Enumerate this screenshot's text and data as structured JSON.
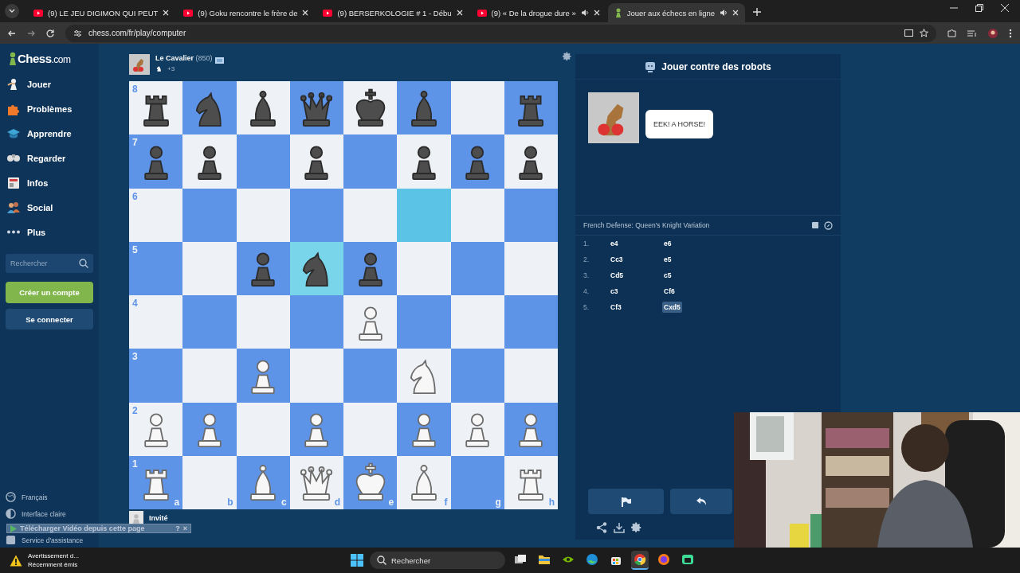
{
  "browser": {
    "tabs": [
      {
        "title": "(9) LE JEU DIGIMON QUI PEUT",
        "kind": "youtube",
        "audio": false,
        "selected": false
      },
      {
        "title": "(9) Goku rencontre le frère de",
        "kind": "youtube",
        "audio": false,
        "selected": false
      },
      {
        "title": "(9) BERSERKOLOGIE # 1 - Débu",
        "kind": "youtube",
        "audio": false,
        "selected": false
      },
      {
        "title": "(9) « De la drogue dure »",
        "kind": "youtube",
        "audio": true,
        "selected": false
      },
      {
        "title": "Jouer aux échecs en ligne",
        "kind": "chess",
        "audio": true,
        "selected": true
      }
    ],
    "address": "chess.com/fr/play/computer"
  },
  "sidebar": {
    "logo": {
      "name": "Chess",
      ".com": ".com"
    },
    "nav": [
      {
        "label": "Jouer"
      },
      {
        "label": "Problèmes"
      },
      {
        "label": "Apprendre"
      },
      {
        "label": "Regarder"
      },
      {
        "label": "Infos"
      },
      {
        "label": "Social"
      },
      {
        "label": "Plus"
      }
    ],
    "search": {
      "placeholder": "Rechercher"
    },
    "buttons": [
      {
        "label": "Créer un compte",
        "kind": "primary"
      },
      {
        "label": "Se connecter",
        "kind": "secondary"
      }
    ],
    "footer": [
      {
        "label": "Français"
      },
      {
        "label": "Interface claire"
      },
      {
        "label": "Service d'assistance"
      }
    ]
  },
  "download_bar": {
    "label": "Télécharger Vidéo depuis cette page",
    "help": "?",
    "close": "×"
  },
  "opponent": {
    "name": "Le Cavalier",
    "rating": "(850)",
    "captured": "+3"
  },
  "player": {
    "name": "Invité"
  },
  "board": {
    "files": [
      "a",
      "b",
      "c",
      "d",
      "e",
      "f",
      "g",
      "h"
    ],
    "ranks": [
      {
        "label": "8",
        "squares": [
          {
            "kind": "rook",
            "black": true,
            "highlighted": false
          },
          {
            "kind": "knight",
            "black": true,
            "highlighted": false
          },
          {
            "kind": "bishop",
            "black": true,
            "highlighted": false
          },
          {
            "kind": "queen",
            "black": true,
            "highlighted": false
          },
          {
            "kind": "king",
            "black": true,
            "highlighted": false
          },
          {
            "kind": "bishop",
            "black": true,
            "highlighted": false
          },
          {
            "kind": "empty",
            "highlighted": false
          },
          {
            "kind": "rook",
            "black": true,
            "highlighted": false
          }
        ]
      },
      {
        "label": "7",
        "squares": [
          {
            "kind": "pawn",
            "black": true,
            "highlighted": false
          },
          {
            "kind": "pawn",
            "black": true,
            "highlighted": false
          },
          {
            "kind": "empty",
            "highlighted": false
          },
          {
            "kind": "pawn",
            "black": true,
            "highlighted": false
          },
          {
            "kind": "empty",
            "highlighted": false
          },
          {
            "kind": "pawn",
            "black": true,
            "highlighted": false
          },
          {
            "kind": "pawn",
            "black": true,
            "highlighted": false
          },
          {
            "kind": "pawn",
            "black": true,
            "highlighted": false
          }
        ]
      },
      {
        "label": "6",
        "squares": [
          {
            "kind": "empty",
            "highlighted": false
          },
          {
            "kind": "empty",
            "highlighted": false
          },
          {
            "kind": "empty",
            "highlighted": false
          },
          {
            "kind": "empty",
            "highlighted": false
          },
          {
            "kind": "empty",
            "highlighted": false
          },
          {
            "kind": "empty",
            "highlighted": true
          },
          {
            "kind": "empty",
            "highlighted": false
          },
          {
            "kind": "empty",
            "highlighted": false
          }
        ]
      },
      {
        "label": "5",
        "squares": [
          {
            "kind": "empty",
            "highlighted": false
          },
          {
            "kind": "empty",
            "highlighted": false
          },
          {
            "kind": "pawn",
            "black": true,
            "highlighted": false
          },
          {
            "kind": "knight",
            "black": true,
            "highlighted": true
          },
          {
            "kind": "pawn",
            "black": true,
            "highlighted": false
          },
          {
            "kind": "empty",
            "highlighted": false
          },
          {
            "kind": "empty",
            "highlighted": false
          },
          {
            "kind": "empty",
            "highlighted": false
          }
        ]
      },
      {
        "label": "4",
        "squares": [
          {
            "kind": "empty",
            "highlighted": false
          },
          {
            "kind": "empty",
            "highlighted": false
          },
          {
            "kind": "empty",
            "highlighted": false
          },
          {
            "kind": "empty",
            "highlighted": false
          },
          {
            "kind": "pawn",
            "black": false,
            "highlighted": false
          },
          {
            "kind": "empty",
            "highlighted": false
          },
          {
            "kind": "empty",
            "highlighted": false
          },
          {
            "kind": "empty",
            "highlighted": false
          }
        ]
      },
      {
        "label": "3",
        "squares": [
          {
            "kind": "empty",
            "highlighted": false
          },
          {
            "kind": "empty",
            "highlighted": false
          },
          {
            "kind": "pawn",
            "black": false,
            "highlighted": false
          },
          {
            "kind": "empty",
            "highlighted": false
          },
          {
            "kind": "empty",
            "highlighted": false
          },
          {
            "kind": "knight",
            "black": false,
            "highlighted": false
          },
          {
            "kind": "empty",
            "highlighted": false
          },
          {
            "kind": "empty",
            "highlighted": false
          }
        ]
      },
      {
        "label": "2",
        "squares": [
          {
            "kind": "pawn",
            "black": false,
            "highlighted": false
          },
          {
            "kind": "pawn",
            "black": false,
            "highlighted": false
          },
          {
            "kind": "empty",
            "highlighted": false
          },
          {
            "kind": "pawn",
            "black": false,
            "highlighted": false
          },
          {
            "kind": "empty",
            "highlighted": false
          },
          {
            "kind": "pawn",
            "black": false,
            "highlighted": false
          },
          {
            "kind": "pawn",
            "black": false,
            "highlighted": false
          },
          {
            "kind": "pawn",
            "black": false,
            "highlighted": false
          }
        ]
      },
      {
        "label": "1",
        "squares": [
          {
            "kind": "rook",
            "black": false,
            "highlighted": false
          },
          {
            "kind": "empty",
            "highlighted": false
          },
          {
            "kind": "bishop",
            "black": false,
            "highlighted": false
          },
          {
            "kind": "queen",
            "black": false,
            "highlighted": false
          },
          {
            "kind": "king",
            "black": false,
            "highlighted": false
          },
          {
            "kind": "bishop",
            "black": false,
            "highlighted": false
          },
          {
            "kind": "empty",
            "highlighted": false
          },
          {
            "kind": "rook",
            "black": false,
            "highlighted": false
          }
        ]
      }
    ]
  },
  "panel": {
    "title": "Jouer contre des robots",
    "bot_message": "EEK! A HORSE!",
    "opening": "French Defense: Queen's Knight Variation",
    "moves": [
      {
        "number": "1.",
        "white": {
          "san": "e4",
          "selected": false
        },
        "black": {
          "san": "e6",
          "selected": false
        }
      },
      {
        "number": "2.",
        "white": {
          "san": "Cc3",
          "selected": false
        },
        "black": {
          "san": "e5",
          "selected": false
        }
      },
      {
        "number": "3.",
        "white": {
          "san": "Cd5",
          "selected": false
        },
        "black": {
          "san": "c5",
          "selected": false
        }
      },
      {
        "number": "4.",
        "white": {
          "san": "c3",
          "selected": false
        },
        "black": {
          "san": "Cf6",
          "selected": false
        }
      },
      {
        "number": "5.",
        "white": {
          "san": "Cf3",
          "selected": false
        },
        "black": {
          "san": "Cxd5",
          "selected": true
        }
      }
    ]
  },
  "taskbar": {
    "notification": {
      "title": "Avertissement d...",
      "subtitle": "Récemment émis"
    },
    "search": {
      "placeholder": "Rechercher"
    },
    "apps": [
      {
        "kind": "taskview",
        "selected": false
      },
      {
        "kind": "files",
        "selected": false
      },
      {
        "kind": "nvidia",
        "selected": false
      },
      {
        "kind": "edge",
        "selected": false
      },
      {
        "kind": "store",
        "selected": false
      },
      {
        "kind": "chrome",
        "selected": true
      },
      {
        "kind": "firefox",
        "selected": false
      },
      {
        "kind": "terminal",
        "selected": false
      }
    ]
  }
}
